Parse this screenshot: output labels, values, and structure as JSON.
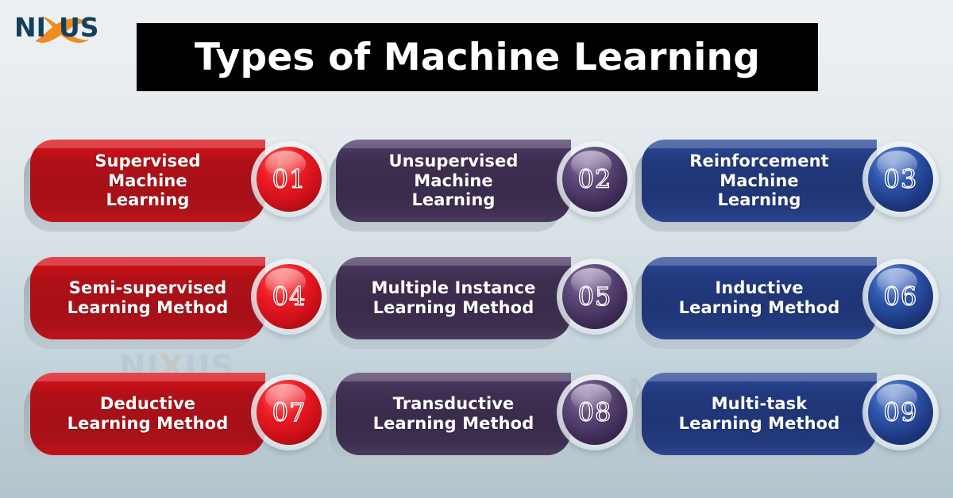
{
  "brand": {
    "logo_text_before": "NI",
    "logo_text_x": "X",
    "logo_text_after": "US",
    "logo_name": "NIXUS",
    "navy": "#12405c",
    "orange": "#ef8b23"
  },
  "header": {
    "title": "Types of Machine Learning",
    "bar_color": "#010101",
    "title_color": "#ffffff"
  },
  "background": {
    "top_color": "#edf0f3",
    "bottom_color": "#b2c5ce",
    "watermark_text": "NIXUS"
  },
  "palette": {
    "red": "#b01118",
    "purple": "#3e2f51",
    "blue": "#22397d"
  },
  "cards": [
    {
      "number": "01",
      "label": "Supervised\nMachine\nLearning",
      "color": "red",
      "lines": 3
    },
    {
      "number": "02",
      "label": "Unsupervised\nMachine\nLearning",
      "color": "purple",
      "lines": 3
    },
    {
      "number": "03",
      "label": "Reinforcement\nMachine\nLearning",
      "color": "blue",
      "lines": 3
    },
    {
      "number": "04",
      "label": "Semi-supervised\nLearning Method",
      "color": "red",
      "lines": 2
    },
    {
      "number": "05",
      "label": "Multiple Instance\nLearning Method",
      "color": "purple",
      "lines": 2
    },
    {
      "number": "06",
      "label": "Inductive\nLearning Method",
      "color": "blue",
      "lines": 2
    },
    {
      "number": "07",
      "label": "Deductive\nLearning Method",
      "color": "red",
      "lines": 2
    },
    {
      "number": "08",
      "label": "Transductive\nLearning Method",
      "color": "purple",
      "lines": 2
    },
    {
      "number": "09",
      "label": "Multi-task\nLearning Method",
      "color": "blue",
      "lines": 2
    }
  ]
}
